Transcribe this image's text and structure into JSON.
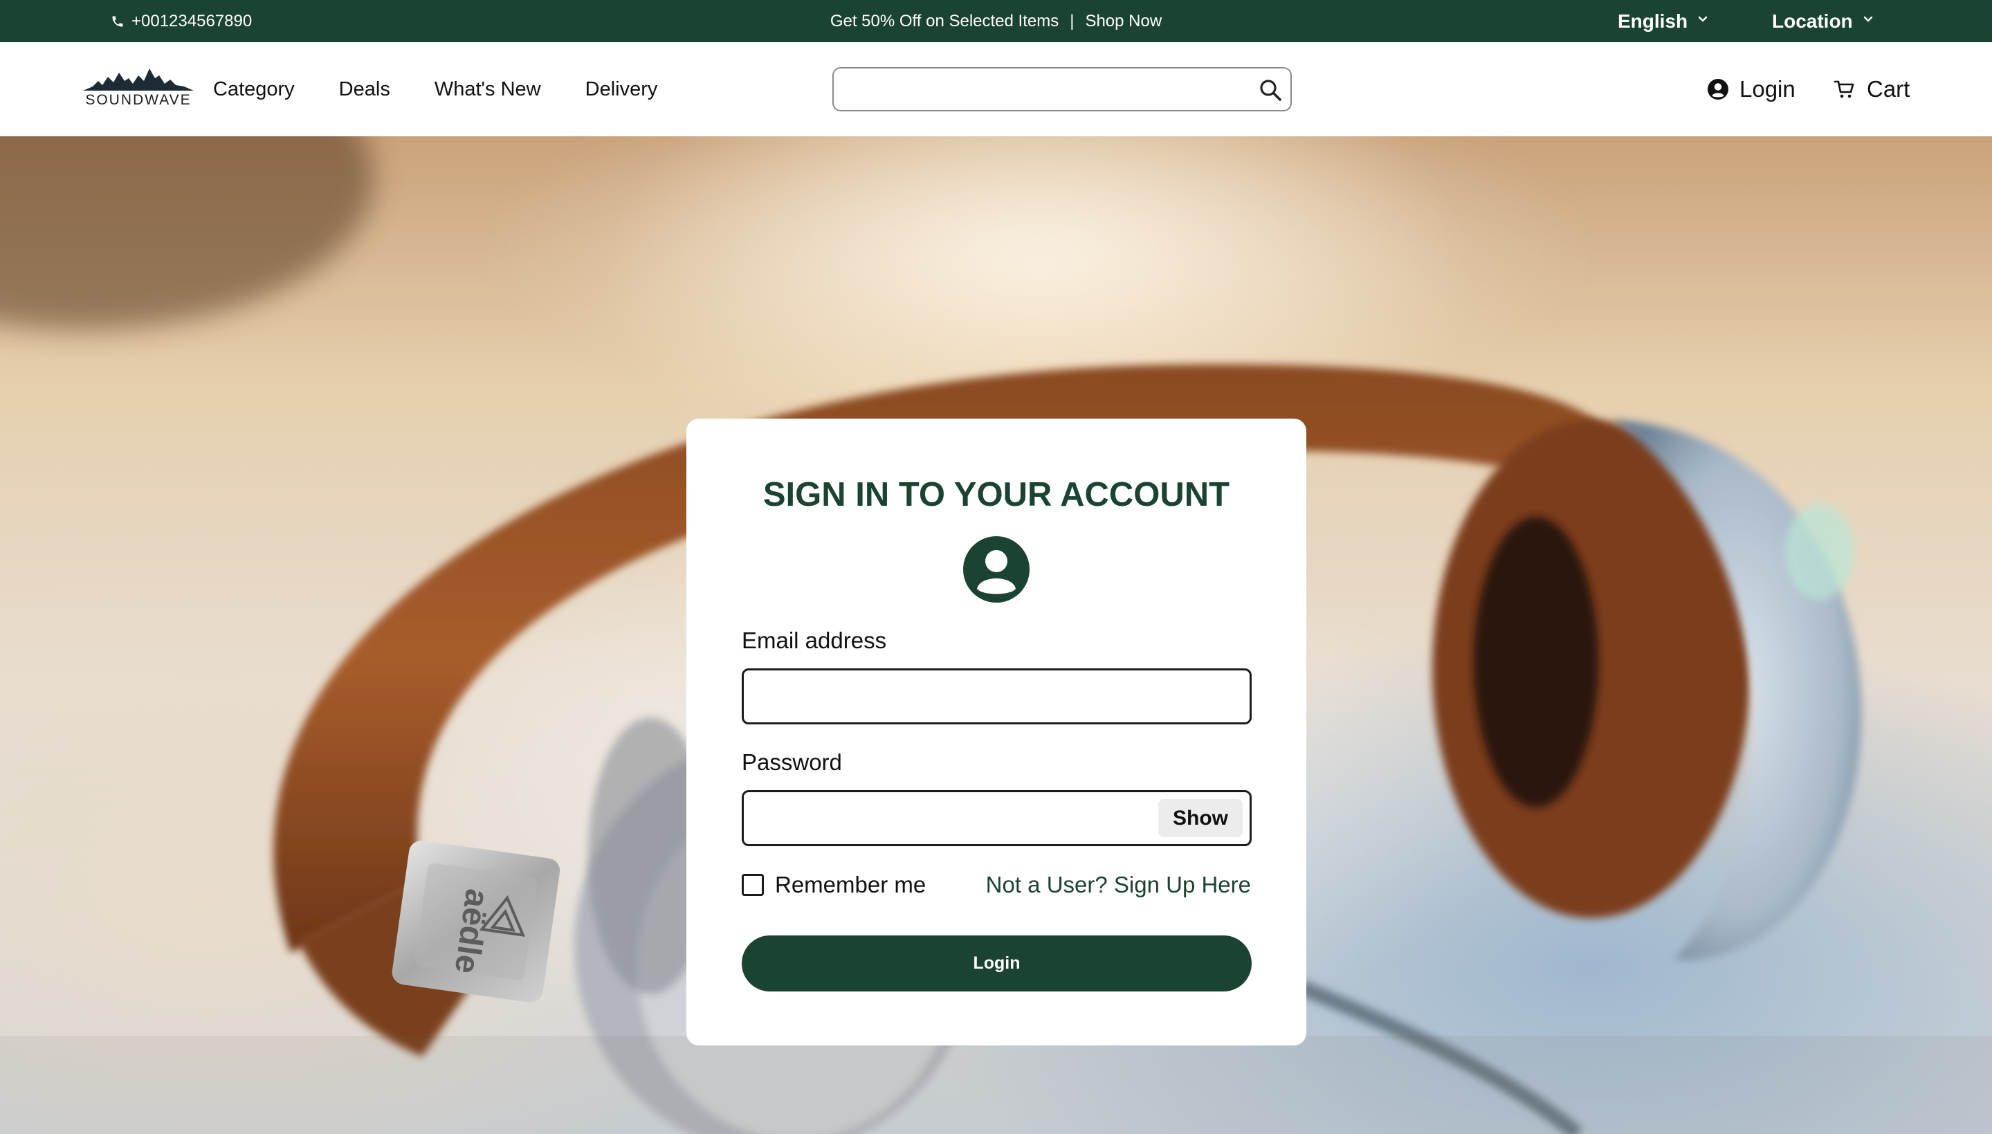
{
  "topbar": {
    "phone": "+001234567890",
    "promo_text": "Get 50% Off on Selected Items",
    "separator": "|",
    "shop_now": "Shop Now",
    "language": "English",
    "location": "Location"
  },
  "header": {
    "logo_text": "SOUNDWAVE",
    "nav": [
      "Category",
      "Deals",
      "What's New",
      "Delivery"
    ],
    "search_value": "",
    "login_label": "Login",
    "cart_label": "Cart"
  },
  "login_card": {
    "title": "SIGN IN TO YOUR ACCOUNT",
    "email_label": "Email address",
    "email_value": "",
    "password_label": "Password",
    "password_value": "",
    "show_label": "Show",
    "remember_label": "Remember me",
    "remember_checked": false,
    "signup_link": "Not a User? Sign Up Here",
    "login_button": "Login"
  },
  "hero": {
    "image_subject": "headphones-photo",
    "earcup_brand_text": "aëdle"
  },
  "colors": {
    "brand_green": "#1b4332",
    "white": "#ffffff",
    "text": "#111111"
  }
}
